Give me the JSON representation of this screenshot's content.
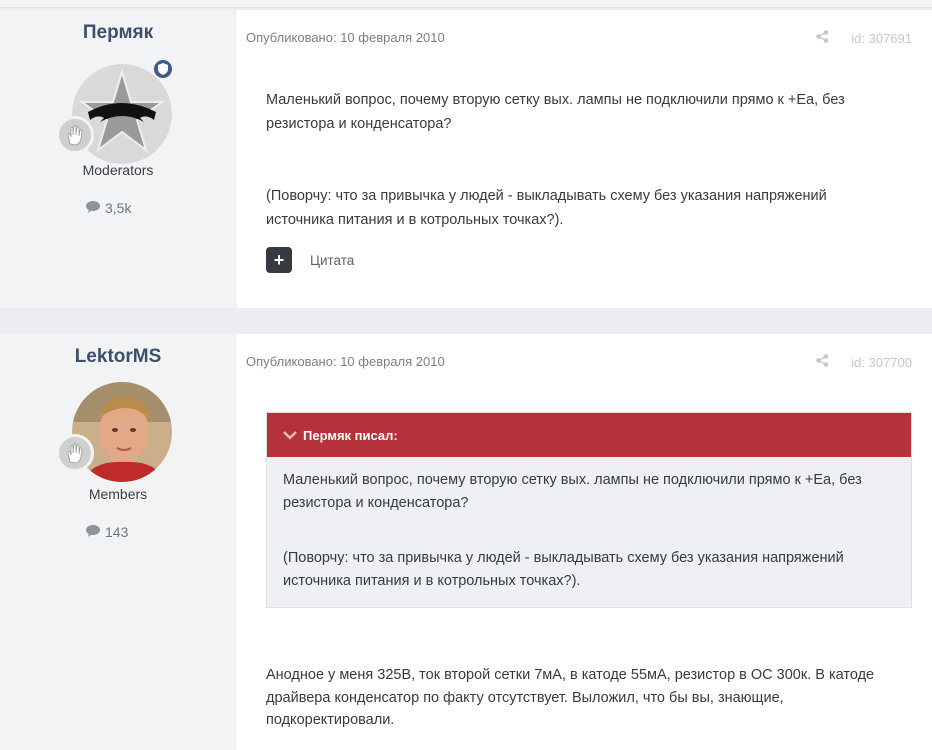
{
  "posts": [
    {
      "author": "Пермяк",
      "group": "Moderators",
      "post_count": "3,5k",
      "published": "Опубликовано: 10 февраля 2010",
      "post_id": "id: 307691",
      "paragraphs": [
        "Маленький вопрос, почему вторую сетку вых. лампы не подключили прямо к +Еа, без резистора и конденсатора?",
        "(Поворчу: что за привычка у людей - выкладывать схему без указания напряжений источника питания и в котрольных точках?)."
      ],
      "quote_label": "Цитата"
    },
    {
      "author": "LektorMS",
      "group": "Members",
      "post_count": "143",
      "published": "Опубликовано: 10 февраля 2010",
      "post_id": "id: 307700",
      "quote": {
        "header": "Пермяк писал:",
        "paragraphs": [
          "Маленький вопрос, почему вторую сетку вых. лампы не подключили прямо к +Еа, без резистора и конденсатора?",
          "(Поворчу: что за привычка у людей - выкладывать схему без указания напряжений источника питания и в котрольных точках?)."
        ]
      },
      "paragraphs": [
        "Анодное у меня 325В, ток второй сетки 7мА, в катоде 55мА, резистор в ОС 300к. В катоде драйвера конденсатор по факту отсутствует. Выложил, что бы вы, знающие, подкоректировали."
      ]
    }
  ],
  "colors": {
    "quote_header": "#b5323a",
    "author_name": "#3d4f6c",
    "moderator_badge": "#3d5b8a"
  },
  "icons": [
    "share-icon",
    "comment-icon",
    "shield-icon",
    "hand-icon",
    "plus-icon",
    "chevron-down-icon"
  ]
}
